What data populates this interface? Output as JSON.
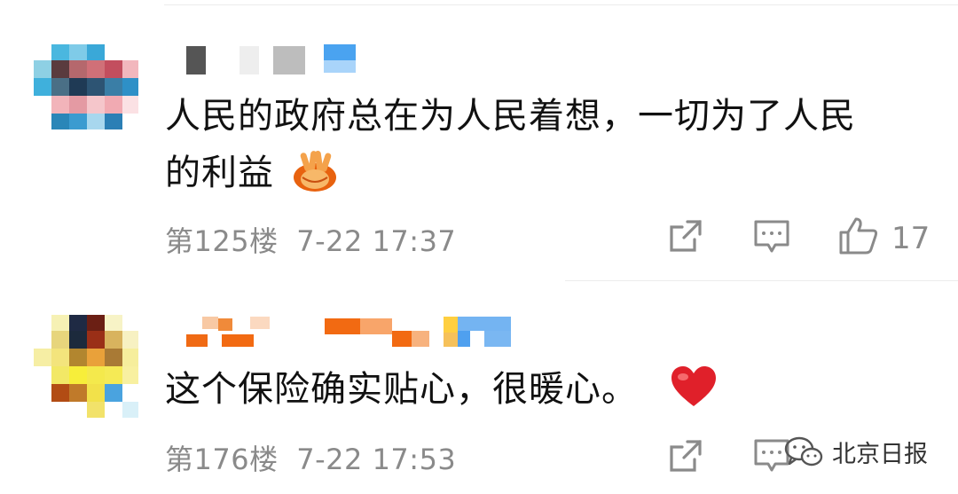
{
  "comments": [
    {
      "text_line1": "人民的政府总在为人民着想，一切为了人民",
      "text_line2": "的利益",
      "emoji": "victory-hands-emoji",
      "floor": "第125楼",
      "time": "7-22 17:37",
      "likes": "17"
    },
    {
      "text_line1": "这个保险确实贴心，很暖心。",
      "emoji": "red-heart-emoji",
      "floor": "第176楼",
      "time": "7-22 17:53"
    }
  ],
  "watermark": {
    "text": "北京日报",
    "icon": "wechat-icon"
  },
  "colors": {
    "meta_gray": "#8a8a8a",
    "heart_red": "#e0202a",
    "emoji_orange": "#f07a18"
  }
}
